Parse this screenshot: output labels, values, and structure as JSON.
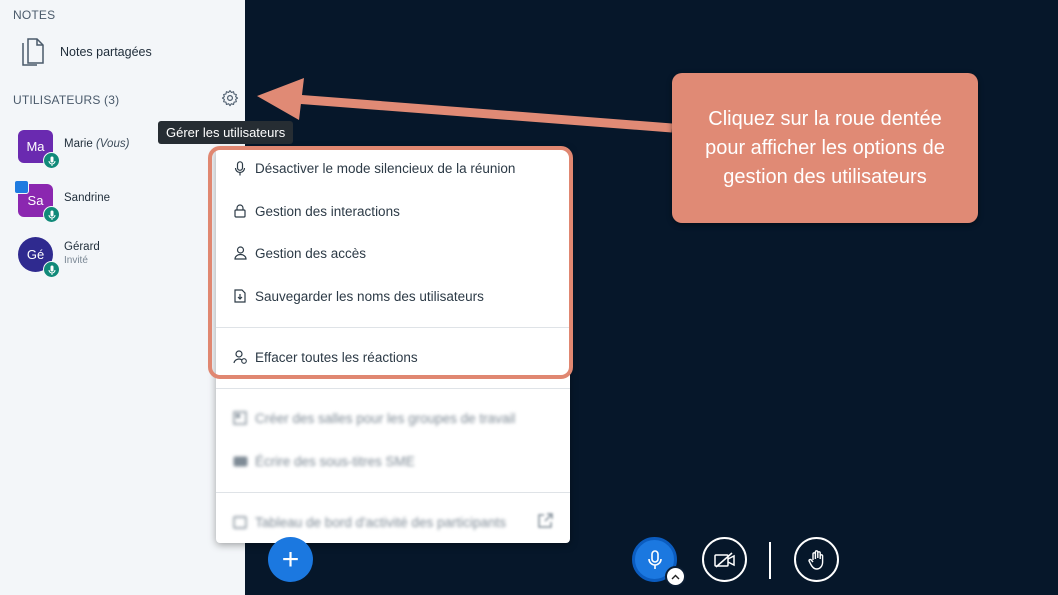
{
  "sidebar": {
    "notes_title": "NOTES",
    "shared_notes": "Notes partagées",
    "users_title": "UTILISATEURS (3)",
    "users": [
      {
        "initials": "Ma",
        "name": "Marie",
        "suffix": "(Vous)",
        "role": "",
        "color": "#6a2ab0"
      },
      {
        "initials": "Sa",
        "name": "Sandrine",
        "suffix": "",
        "role": "",
        "color": "#8b27b0"
      },
      {
        "initials": "Gé",
        "name": "Gérard",
        "suffix": "",
        "role": "Invité",
        "color": "#2f2a8f"
      }
    ]
  },
  "tooltip": "Gérer les utilisateurs",
  "menu": {
    "items": [
      "Désactiver le mode silencieux de la réunion",
      "Gestion des interactions",
      "Gestion des accès",
      "Sauvegarder les noms des utilisateurs",
      "Effacer toutes les réactions",
      "Créer des salles pour les groupes de travail",
      "Écrire des sous-titres SME",
      "Tableau de bord d'activité des participants"
    ]
  },
  "callout": "Cliquez sur la roue dentée pour afficher les options de gestion des utilisateurs",
  "colors": {
    "accent": "#1b78e0",
    "callout": "#e08a75",
    "background": "#06172a"
  },
  "controls": {
    "add": "+"
  }
}
